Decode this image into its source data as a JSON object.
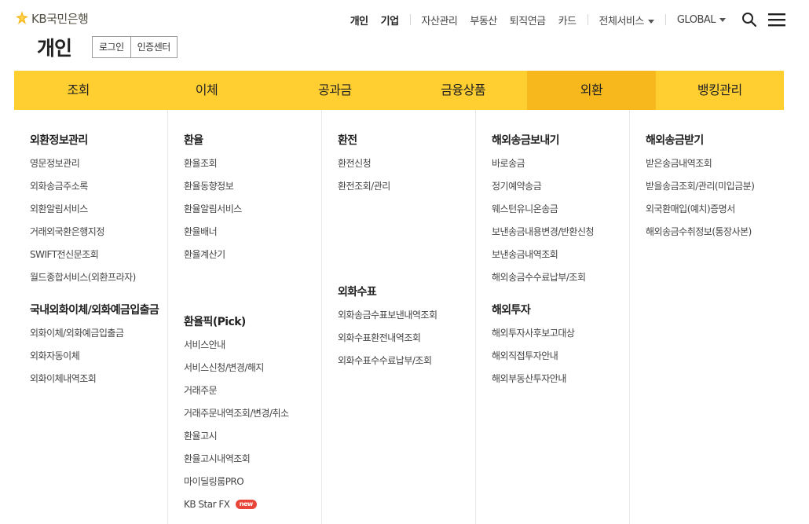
{
  "logo": {
    "text": "KB국민은행"
  },
  "gnb": {
    "personal": "개인",
    "business": "기업",
    "wealth": "자산관리",
    "realestate": "부동산",
    "pension": "퇴직연금",
    "card": "카드",
    "all_services": "전체서비스",
    "global": "GLOBAL"
  },
  "page": {
    "title": "개인",
    "login": "로그인",
    "cert_center": "인증센터"
  },
  "mainnav": [
    "조회",
    "이체",
    "공과금",
    "금융상품",
    "외환",
    "뱅킹관리"
  ],
  "mega": {
    "col1": {
      "g1": {
        "title": "외환정보관리",
        "items": [
          "영문정보관리",
          "외화송금주소록",
          "외환알림서비스",
          "거래외국환은행지정",
          "SWIFT전신문조회",
          "월드종합서비스(외환프라자)"
        ]
      },
      "g2": {
        "title": "국내외화이체/외화예금입출금",
        "items": [
          "외화이체/외화예금입출금",
          "외화자동이체",
          "외화이체내역조회"
        ]
      }
    },
    "col2": {
      "g1": {
        "title": "환율",
        "items": [
          "환율조회",
          "환율동향정보",
          "환율알림서비스",
          "환율배너",
          "환율계산기"
        ]
      },
      "g2": {
        "title": "환율픽(Pick)",
        "items": [
          "서비스안내",
          "서비스신청/변경/해지",
          "거래주문",
          "거래주문내역조회/변경/취소",
          "환율고시",
          "환율고시내역조회",
          "마이딜링룸PRO",
          "KB Star FX"
        ],
        "badge": "new"
      }
    },
    "col3": {
      "g1": {
        "title": "환전",
        "items": [
          "환전신청",
          "환전조회/관리"
        ]
      },
      "g2": {
        "title": "외화수표",
        "items": [
          "외화송금수표보낸내역조회",
          "외화수표환전내역조회",
          "외화수표수수료납부/조회"
        ]
      }
    },
    "col4": {
      "g1": {
        "title": "해외송금보내기",
        "items": [
          "바로송금",
          "정기예약송금",
          "웨스턴유니온송금",
          "보낸송금내용변경/반환신청",
          "보낸송금내역조회",
          "해외송금수수료납부/조회"
        ]
      },
      "g2": {
        "title": "해외투자",
        "items": [
          "해외투자사후보고대상",
          "해외직접투자안내",
          "해외부동산투자안내"
        ]
      }
    },
    "col5": {
      "g1": {
        "title": "해외송금받기",
        "items": [
          "받은송금내역조회",
          "받을송금조회/관리(미입금분)",
          "외국환매입(예치)증명서",
          "해외송금수취정보(통장사본)"
        ]
      }
    }
  },
  "colors": {
    "brand_yellow": "#ffcf32",
    "active_tab": "#f6b81c",
    "badge": "#e8463a"
  },
  "icons": {
    "logo": "kb-star-icon",
    "search": "search-icon",
    "menu": "hamburger-icon"
  }
}
